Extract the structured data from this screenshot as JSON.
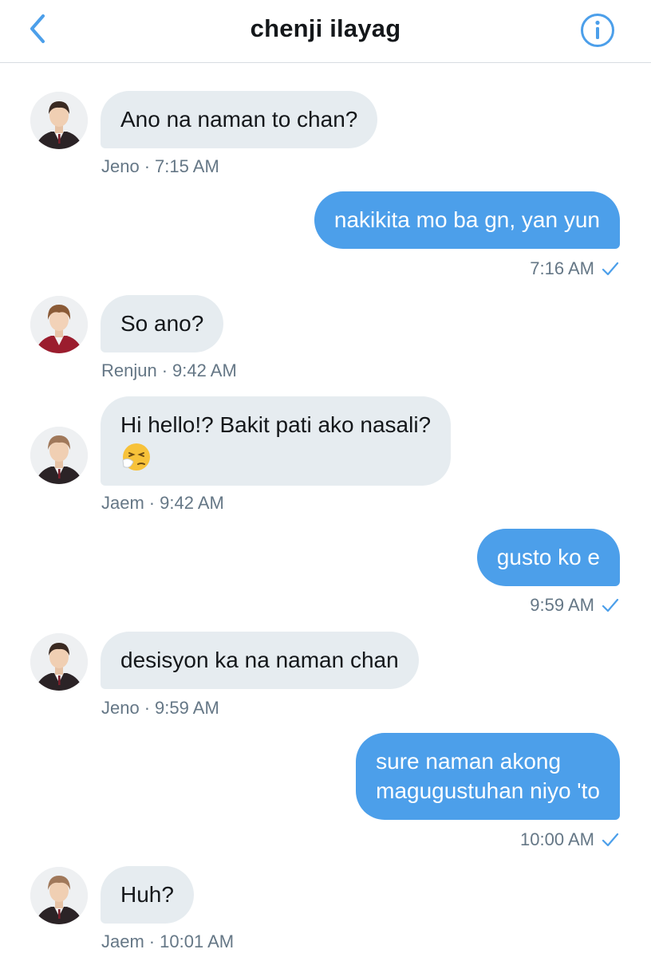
{
  "header": {
    "title": "chenji ilayag",
    "back_icon": "chevron-left-icon",
    "info_icon": "info-icon",
    "accent_color": "#4c9fea"
  },
  "messages": [
    {
      "direction": "in",
      "sender": "Jeno",
      "text": "Ano na naman to chan?",
      "time": "7:15 AM"
    },
    {
      "direction": "out",
      "text": "nakikita mo ba gn, yan yun",
      "time": "7:16 AM",
      "status_icon": "check-icon"
    },
    {
      "direction": "in",
      "sender": "Renjun",
      "text": "So ano?",
      "time": "9:42 AM"
    },
    {
      "direction": "in",
      "sender": "Jaem",
      "text": "Hi hello!? Bakit pati ako nasali?",
      "emoji": "sneezing-face-emoji",
      "time": "9:42 AM"
    },
    {
      "direction": "out",
      "text": "gusto ko e",
      "time": "9:59 AM",
      "status_icon": "check-icon"
    },
    {
      "direction": "in",
      "sender": "Jeno",
      "text": "desisyon ka na naman chan",
      "time": "9:59 AM"
    },
    {
      "direction": "out",
      "text_line1": "sure naman akong",
      "text_line2": "magugustuhan niyo 'to",
      "time": "10:00 AM",
      "status_icon": "check-icon"
    },
    {
      "direction": "in",
      "sender": "Jaem",
      "text": "Huh?",
      "time": "10:01 AM"
    }
  ],
  "separator": "·"
}
